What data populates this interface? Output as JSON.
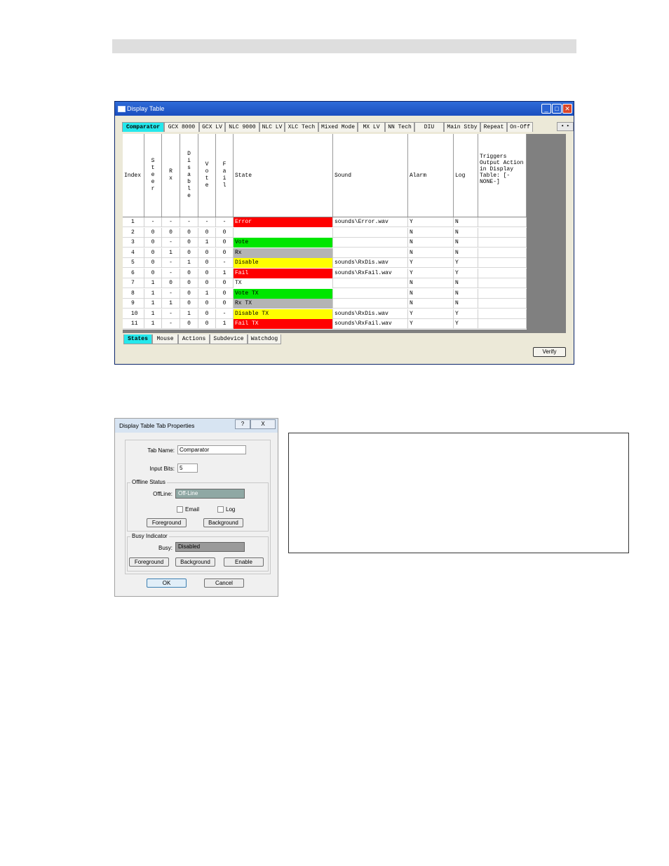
{
  "window": {
    "title": "Display Table",
    "top_tabs": [
      "Comparator",
      "GCX 8000",
      "GCX LV",
      "NLC 9000",
      "NLC LV",
      "XLC Tech",
      "Mixed Mode",
      "MX LV",
      "NN Tech",
      "DIU",
      "Main Stby",
      "Repeat",
      "On-Off"
    ],
    "columns": [
      "Index",
      "Steer",
      "Rx",
      "Disable",
      "Vote",
      "Fail",
      "State",
      "Sound",
      "Alarm",
      "Log",
      "Triggers Output Action in Display Table: [-NONE-]"
    ],
    "rows": [
      {
        "index": "1",
        "steer": "-",
        "rx": "-",
        "disable": "-",
        "vote": "-",
        "fail": "-",
        "state": "Error",
        "state_color": "#ff0000",
        "sound": "sounds\\Error.wav",
        "alarm": "Y",
        "log": "N"
      },
      {
        "index": "2",
        "steer": "0",
        "rx": "0",
        "disable": "0",
        "vote": "0",
        "fail": "0",
        "state": "",
        "state_color": "#ffffff",
        "sound": "",
        "alarm": "N",
        "log": "N"
      },
      {
        "index": "3",
        "steer": "0",
        "rx": "-",
        "disable": "0",
        "vote": "1",
        "fail": "0",
        "state": "Vote",
        "state_color": "#00e600",
        "sound": "",
        "alarm": "N",
        "log": "N"
      },
      {
        "index": "4",
        "steer": "0",
        "rx": "1",
        "disable": "0",
        "vote": "0",
        "fail": "0",
        "state": "Rx",
        "state_color": "#b4b4b4",
        "sound": "",
        "alarm": "N",
        "log": "N"
      },
      {
        "index": "5",
        "steer": "0",
        "rx": "-",
        "disable": "1",
        "vote": "0",
        "fail": "-",
        "state": "Disable",
        "state_color": "#ffff00",
        "sound": "sounds\\RxDis.wav",
        "alarm": "Y",
        "log": "Y"
      },
      {
        "index": "6",
        "steer": "0",
        "rx": "-",
        "disable": "0",
        "vote": "0",
        "fail": "1",
        "state": "Fail",
        "state_color": "#ff0000",
        "sound": "sounds\\RxFail.wav",
        "alarm": "Y",
        "log": "Y"
      },
      {
        "index": "7",
        "steer": "1",
        "rx": "0",
        "disable": "0",
        "vote": "0",
        "fail": "0",
        "state": "TX",
        "state_color": "#ffffff",
        "sound": "",
        "alarm": "N",
        "log": "N"
      },
      {
        "index": "8",
        "steer": "1",
        "rx": "-",
        "disable": "0",
        "vote": "1",
        "fail": "0",
        "state": "Vote TX",
        "state_color": "#00e600",
        "sound": "",
        "alarm": "N",
        "log": "N"
      },
      {
        "index": "9",
        "steer": "1",
        "rx": "1",
        "disable": "0",
        "vote": "0",
        "fail": "0",
        "state": "Rx TX",
        "state_color": "#b4b4b4",
        "sound": "",
        "alarm": "N",
        "log": "N"
      },
      {
        "index": "10",
        "steer": "1",
        "rx": "-",
        "disable": "1",
        "vote": "0",
        "fail": "-",
        "state": "Disable TX",
        "state_color": "#ffff00",
        "sound": "sounds\\RxDis.wav",
        "alarm": "Y",
        "log": "Y"
      },
      {
        "index": "11",
        "steer": "1",
        "rx": "-",
        "disable": "0",
        "vote": "0",
        "fail": "1",
        "state": "Fail TX",
        "state_color": "#ff0000",
        "sound": "sounds\\RxFail.wav",
        "alarm": "Y",
        "log": "Y"
      }
    ],
    "bottom_tabs": [
      "States",
      "Mouse",
      "Actions",
      "Subdevice",
      "Watchdog"
    ],
    "verify_label": "Verify"
  },
  "dialog": {
    "title": "Display Table Tab Properties",
    "help": "?",
    "close": "X",
    "tab_name_label": "Tab Name:",
    "tab_name_value": "Comparator",
    "input_bits_label": "Input Bits:",
    "input_bits_value": "5",
    "offline_group": "Offline Status",
    "offline_label": "OffLine:",
    "offline_value": "Off-Line",
    "offline_color": "#8fa8a4",
    "email_label": "Email",
    "log_label": "Log",
    "foreground": "Foreground",
    "background": "Background",
    "busy_group": "Busy Indicator",
    "busy_label": "Busy:",
    "busy_value": "Disabled",
    "busy_color": "#9a9a9a",
    "enable": "Enable",
    "ok": "OK",
    "cancel": "Cancel"
  }
}
